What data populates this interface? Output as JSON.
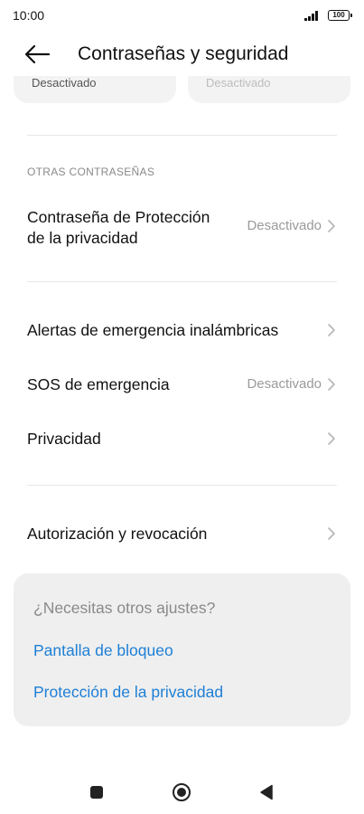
{
  "status_bar": {
    "time": "10:00",
    "battery": "100"
  },
  "header": {
    "title": "Contraseñas y seguridad",
    "back_icon": "arrow-left-icon"
  },
  "top_cards": [
    {
      "value": "Desactivado"
    },
    {
      "value": "Desactivado"
    }
  ],
  "section_other_passwords": {
    "header": "OTRAS CONTRASEÑAS"
  },
  "rows": [
    {
      "label_line1": "Contraseña de Protección",
      "label_line2": "de la privacidad",
      "value": "Desactivado"
    },
    {
      "label": "Alertas de emergencia inalámbricas"
    },
    {
      "label": "SOS de emergencia",
      "value": "Desactivado"
    },
    {
      "label": "Privacidad"
    },
    {
      "label": "Autorización y revocación"
    }
  ],
  "suggestions": {
    "title": "¿Necesitas otros ajustes?",
    "links": [
      "Pantalla de bloqueo",
      "Protección de la privacidad"
    ]
  },
  "nav_bar": {
    "icons": [
      "recents-square-icon",
      "home-circle-icon",
      "back-triangle-icon"
    ]
  },
  "colors": {
    "link": "#1e7fd6",
    "card_background": "#efefef",
    "secondary_text": "#9a9a9a"
  }
}
